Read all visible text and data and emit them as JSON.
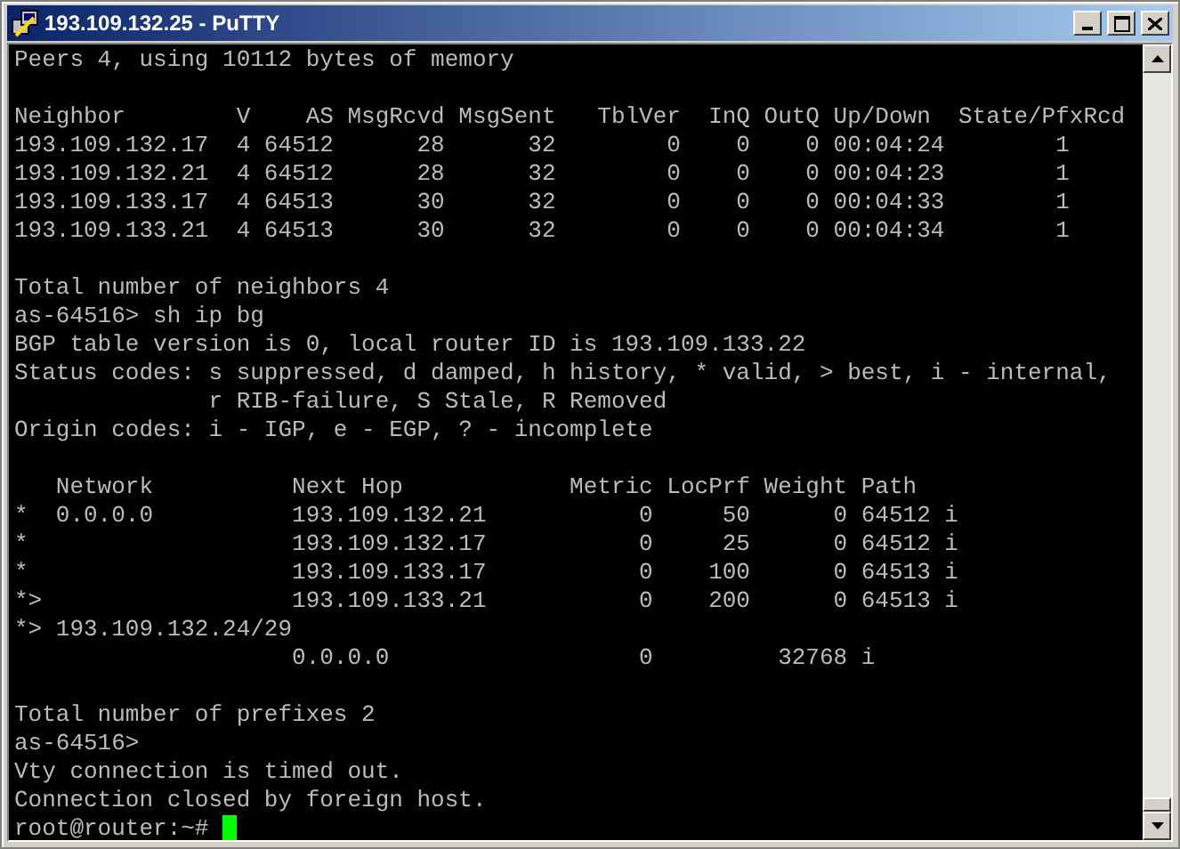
{
  "window": {
    "title": "193.109.132.25 - PuTTY"
  },
  "terminal": {
    "blocks": [
      [
        "Peers 4, using 10112 bytes of memory"
      ],
      [
        "Neighbor        V    AS MsgRcvd MsgSent   TblVer  InQ OutQ Up/Down  State/PfxRcd",
        "193.109.132.17  4 64512      28      32        0    0    0 00:04:24        1",
        "193.109.132.21  4 64512      28      32        0    0    0 00:04:23        1",
        "193.109.133.17  4 64513      30      32        0    0    0 00:04:33        1",
        "193.109.133.21  4 64513      30      32        0    0    0 00:04:34        1"
      ],
      [
        "Total number of neighbors 4",
        "as-64516> sh ip bg",
        "BGP table version is 0, local router ID is 193.109.133.22",
        "Status codes: s suppressed, d damped, h history, * valid, > best, i - internal,",
        "              r RIB-failure, S Stale, R Removed",
        "Origin codes: i - IGP, e - EGP, ? - incomplete"
      ],
      [
        "   Network          Next Hop            Metric LocPrf Weight Path",
        "*  0.0.0.0          193.109.132.21           0     50      0 64512 i",
        "*                   193.109.132.17           0     25      0 64512 i",
        "*                   193.109.133.17           0    100      0 64513 i",
        "*>                  193.109.133.21           0    200      0 64513 i",
        "*> 193.109.132.24/29",
        "                    0.0.0.0                  0         32768 i"
      ],
      [
        "Total number of prefixes 2",
        "as-64516>",
        "Vty connection is timed out.",
        "Connection closed by foreign host.",
        "root@router:~# "
      ]
    ]
  }
}
